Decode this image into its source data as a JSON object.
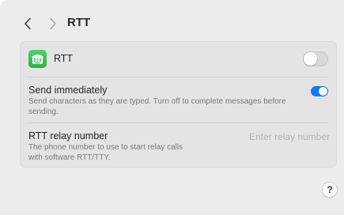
{
  "header": {
    "title": "RTT",
    "back_icon": "chevron-left-icon",
    "forward_icon": "chevron-right-icon"
  },
  "rtt_row": {
    "icon": "rtt-phone-icon",
    "label": "RTT",
    "enabled": false
  },
  "send_immediately": {
    "title": "Send immediately",
    "description": "Send characters as they are typed. Turn off to complete messages before sending.",
    "enabled": true
  },
  "relay_number": {
    "title": "RTT relay number",
    "description": "The phone number to use to start relay calls with software RTT/TTY.",
    "value": "",
    "placeholder": "Enter relay number"
  },
  "help": {
    "label": "?"
  },
  "colors": {
    "accent": "#0a7aff",
    "icon_green": "#34c759",
    "window_bg": "#ececec",
    "card_bg": "#e4e4e4"
  }
}
